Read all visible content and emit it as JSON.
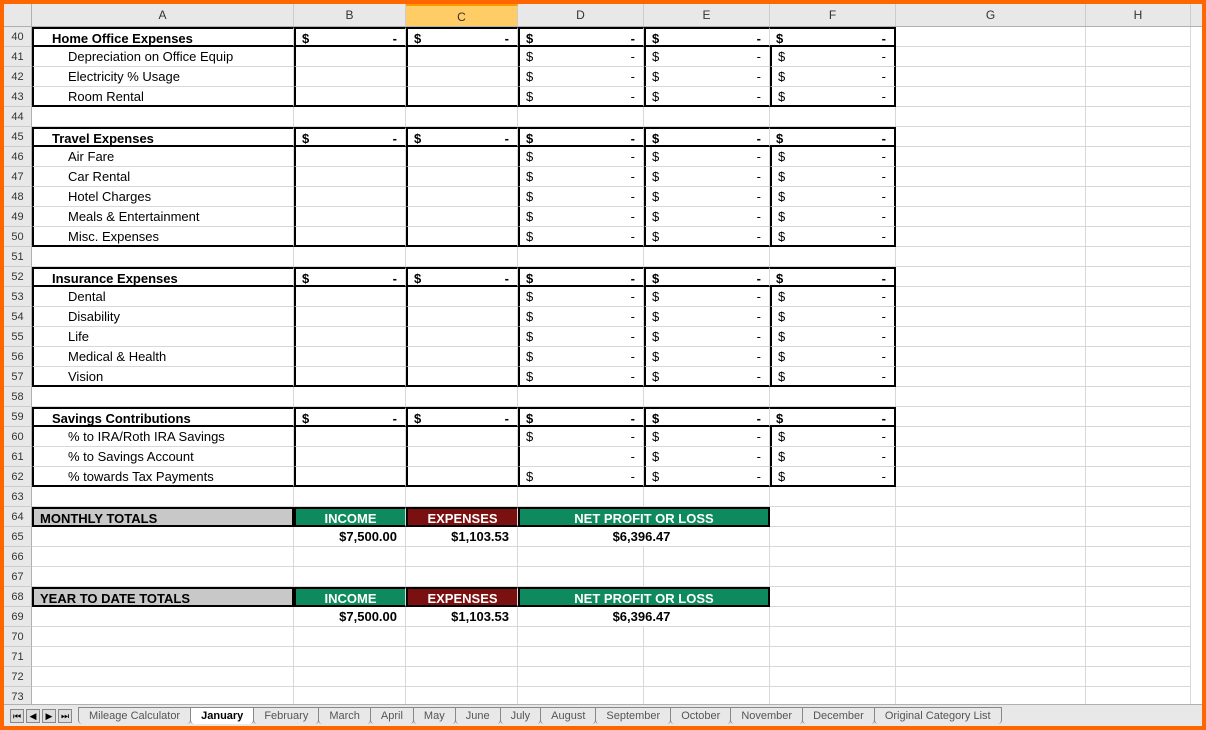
{
  "columns": [
    "A",
    "B",
    "C",
    "D",
    "E",
    "F",
    "G",
    "H"
  ],
  "selected_column": "C",
  "rows": [
    {
      "n": 40,
      "type": "section",
      "label": "Home Office Expenses",
      "cells": {
        "B": "$ -",
        "C": "$ -",
        "D": "$ -",
        "E": "$ -",
        "F": "$ -"
      }
    },
    {
      "n": 41,
      "type": "item",
      "label": "Depreciation on Office Equip",
      "cells": {
        "D": "$ -",
        "E": "$ -",
        "F": "$ -"
      }
    },
    {
      "n": 42,
      "type": "item",
      "label": "Electricity % Usage",
      "cells": {
        "D": "$ -",
        "E": "$ -",
        "F": "$ -"
      }
    },
    {
      "n": 43,
      "type": "item",
      "label": "Room Rental",
      "cells": {
        "D": "$ -",
        "E": "$ -",
        "F": "$ -"
      }
    },
    {
      "n": 44,
      "type": "blank"
    },
    {
      "n": 45,
      "type": "section",
      "label": "Travel Expenses",
      "cells": {
        "B": "$ -",
        "C": "$ -",
        "D": "$ -",
        "E": "$ -",
        "F": "$ -"
      }
    },
    {
      "n": 46,
      "type": "item",
      "label": "Air Fare",
      "cells": {
        "D": "$ -",
        "E": "$ -",
        "F": "$ -"
      }
    },
    {
      "n": 47,
      "type": "item",
      "label": "Car Rental",
      "cells": {
        "D": "$ -",
        "E": "$ -",
        "F": "$ -"
      }
    },
    {
      "n": 48,
      "type": "item",
      "label": "Hotel Charges",
      "cells": {
        "D": "$ -",
        "E": "$ -",
        "F": "$ -"
      }
    },
    {
      "n": 49,
      "type": "item",
      "label": "Meals & Entertainment",
      "cells": {
        "D": "$ -",
        "E": "$ -",
        "F": "$ -"
      }
    },
    {
      "n": 50,
      "type": "item",
      "label": "Misc. Expenses",
      "cells": {
        "D": "$ -",
        "E": "$ -",
        "F": "$ -"
      }
    },
    {
      "n": 51,
      "type": "blank"
    },
    {
      "n": 52,
      "type": "section",
      "label": "Insurance Expenses",
      "cells": {
        "B": "$ -",
        "C": "$ -",
        "D": "$ -",
        "E": "$ -",
        "F": "$ -"
      }
    },
    {
      "n": 53,
      "type": "item",
      "label": "Dental",
      "cells": {
        "D": "$ -",
        "E": "$ -",
        "F": "$ -"
      }
    },
    {
      "n": 54,
      "type": "item",
      "label": "Disability",
      "cells": {
        "D": "$ -",
        "E": "$ -",
        "F": "$ -"
      }
    },
    {
      "n": 55,
      "type": "item",
      "label": "Life",
      "cells": {
        "D": "$ -",
        "E": "$ -",
        "F": "$ -"
      }
    },
    {
      "n": 56,
      "type": "item",
      "label": "Medical & Health",
      "cells": {
        "D": "$ -",
        "E": "$ -",
        "F": "$ -"
      }
    },
    {
      "n": 57,
      "type": "item",
      "label": "Vision",
      "cells": {
        "D": "$ -",
        "E": "$ -",
        "F": "$ -"
      }
    },
    {
      "n": 58,
      "type": "blank"
    },
    {
      "n": 59,
      "type": "section",
      "label": "Savings Contributions",
      "cells": {
        "B": "$ -",
        "C": "$ -",
        "D": "$ -",
        "E": "$ -",
        "F": "$ -"
      }
    },
    {
      "n": 60,
      "type": "item",
      "label": "% to IRA/Roth IRA Savings",
      "cells": {
        "D": "$ -",
        "E": "$ -",
        "F": "$ -"
      }
    },
    {
      "n": 61,
      "type": "item",
      "label": "% to Savings Account",
      "cells": {
        "D": "-",
        "E": "$ -",
        "F": "$ -"
      }
    },
    {
      "n": 62,
      "type": "item",
      "label": "% towards Tax Payments",
      "cells": {
        "D": "$ -",
        "E": "$ -",
        "F": "$ -"
      }
    },
    {
      "n": 63,
      "type": "blank"
    },
    {
      "n": 64,
      "type": "totals-hdr",
      "label": "MONTHLY TOTALS",
      "b": "INCOME",
      "c": "EXPENSES",
      "de": "NET PROFIT OR LOSS"
    },
    {
      "n": 65,
      "type": "totals-val",
      "b": "$7,500.00",
      "c": "$1,103.53",
      "de": "$6,396.47"
    },
    {
      "n": 66,
      "type": "blank"
    },
    {
      "n": 67,
      "type": "blank"
    },
    {
      "n": 68,
      "type": "totals-hdr",
      "label": "YEAR TO DATE TOTALS",
      "b": "INCOME",
      "c": "EXPENSES",
      "de": "NET PROFIT OR LOSS"
    },
    {
      "n": 69,
      "type": "totals-val",
      "b": "$7,500.00",
      "c": "$1,103.53",
      "de": "$6,396.47"
    },
    {
      "n": 70,
      "type": "blank"
    },
    {
      "n": 71,
      "type": "blank"
    },
    {
      "n": 72,
      "type": "blank"
    },
    {
      "n": 73,
      "type": "blank"
    }
  ],
  "tabs": [
    "Mileage Calculator",
    "January",
    "February",
    "March",
    "April",
    "May",
    "June",
    "July",
    "August",
    "September",
    "October",
    "November",
    "December",
    "Original Category List"
  ],
  "active_tab": "January"
}
